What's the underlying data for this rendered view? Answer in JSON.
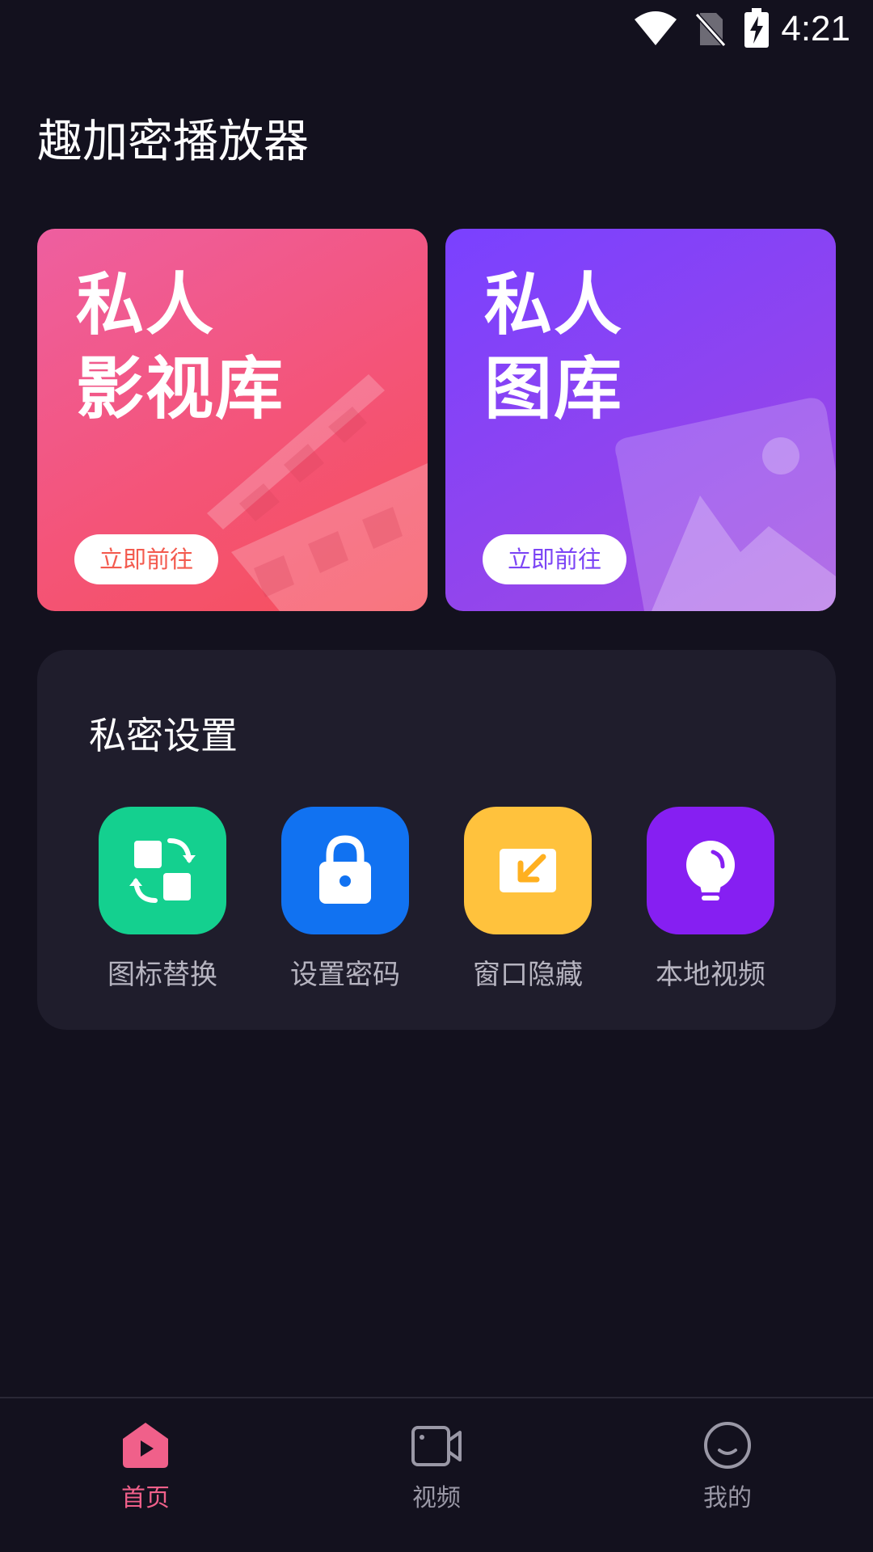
{
  "status_bar": {
    "time": "4:21",
    "icons": [
      "wifi-icon",
      "no-sim-icon",
      "battery-charging-icon"
    ]
  },
  "app": {
    "title": "趣加密播放器"
  },
  "cards": [
    {
      "title_line1": "私人",
      "title_line2": "影视库",
      "button_label": "立即前往",
      "icon": "clapperboard-icon",
      "color": "#f4547a"
    },
    {
      "title_line1": "私人",
      "title_line2": "图库",
      "button_label": "立即前往",
      "icon": "image-icon",
      "color": "#8a44f2"
    }
  ],
  "settings": {
    "title": "私密设置",
    "items": [
      {
        "label": "图标替换",
        "icon": "swap-icon",
        "color": "#14d08f"
      },
      {
        "label": "设置密码",
        "icon": "lock-icon",
        "color": "#1172f1"
      },
      {
        "label": "窗口隐藏",
        "icon": "minimize-window-icon",
        "color": "#ffc23d"
      },
      {
        "label": "本地视频",
        "icon": "lightbulb-icon",
        "color": "#861ff2"
      }
    ]
  },
  "bottom_nav": {
    "items": [
      {
        "label": "首页",
        "icon": "home-play-icon",
        "active": true
      },
      {
        "label": "视频",
        "icon": "video-camera-icon",
        "active": false
      },
      {
        "label": "我的",
        "icon": "smiley-icon",
        "active": false
      }
    ],
    "active_color": "#f0608a",
    "inactive_color": "#9a98a6"
  }
}
